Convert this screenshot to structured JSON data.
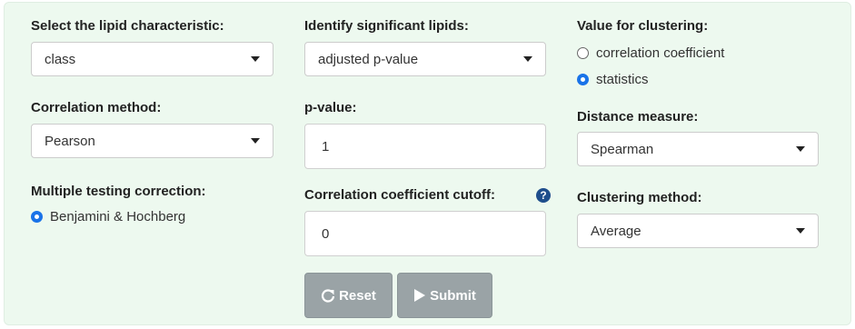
{
  "col1": {
    "lipid_label": "Select the lipid characteristic:",
    "lipid_value": "class",
    "corr_label": "Correlation method:",
    "corr_value": "Pearson",
    "mtc_label": "Multiple testing correction:",
    "mtc_option": "Benjamini & Hochberg"
  },
  "col2": {
    "sig_label": "Identify significant lipids:",
    "sig_value": "adjusted p-value",
    "pval_label": "p-value:",
    "pval_value": "1",
    "cutoff_label": "Correlation coefficient cutoff:",
    "cutoff_value": "0",
    "help_glyph": "?",
    "reset_label": "Reset",
    "submit_label": "Submit"
  },
  "col3": {
    "value_label": "Value for clustering:",
    "option_corr": "correlation coefficient",
    "option_stats": "statistics",
    "dist_label": "Distance measure:",
    "dist_value": "Spearman",
    "clust_label": "Clustering method:",
    "clust_value": "Average"
  },
  "colors": {
    "panel_bg": "#edf9ef",
    "radio_accent": "#1a73e8",
    "button_bg": "#9aa3a6",
    "help_icon": "#1f4e8c"
  }
}
